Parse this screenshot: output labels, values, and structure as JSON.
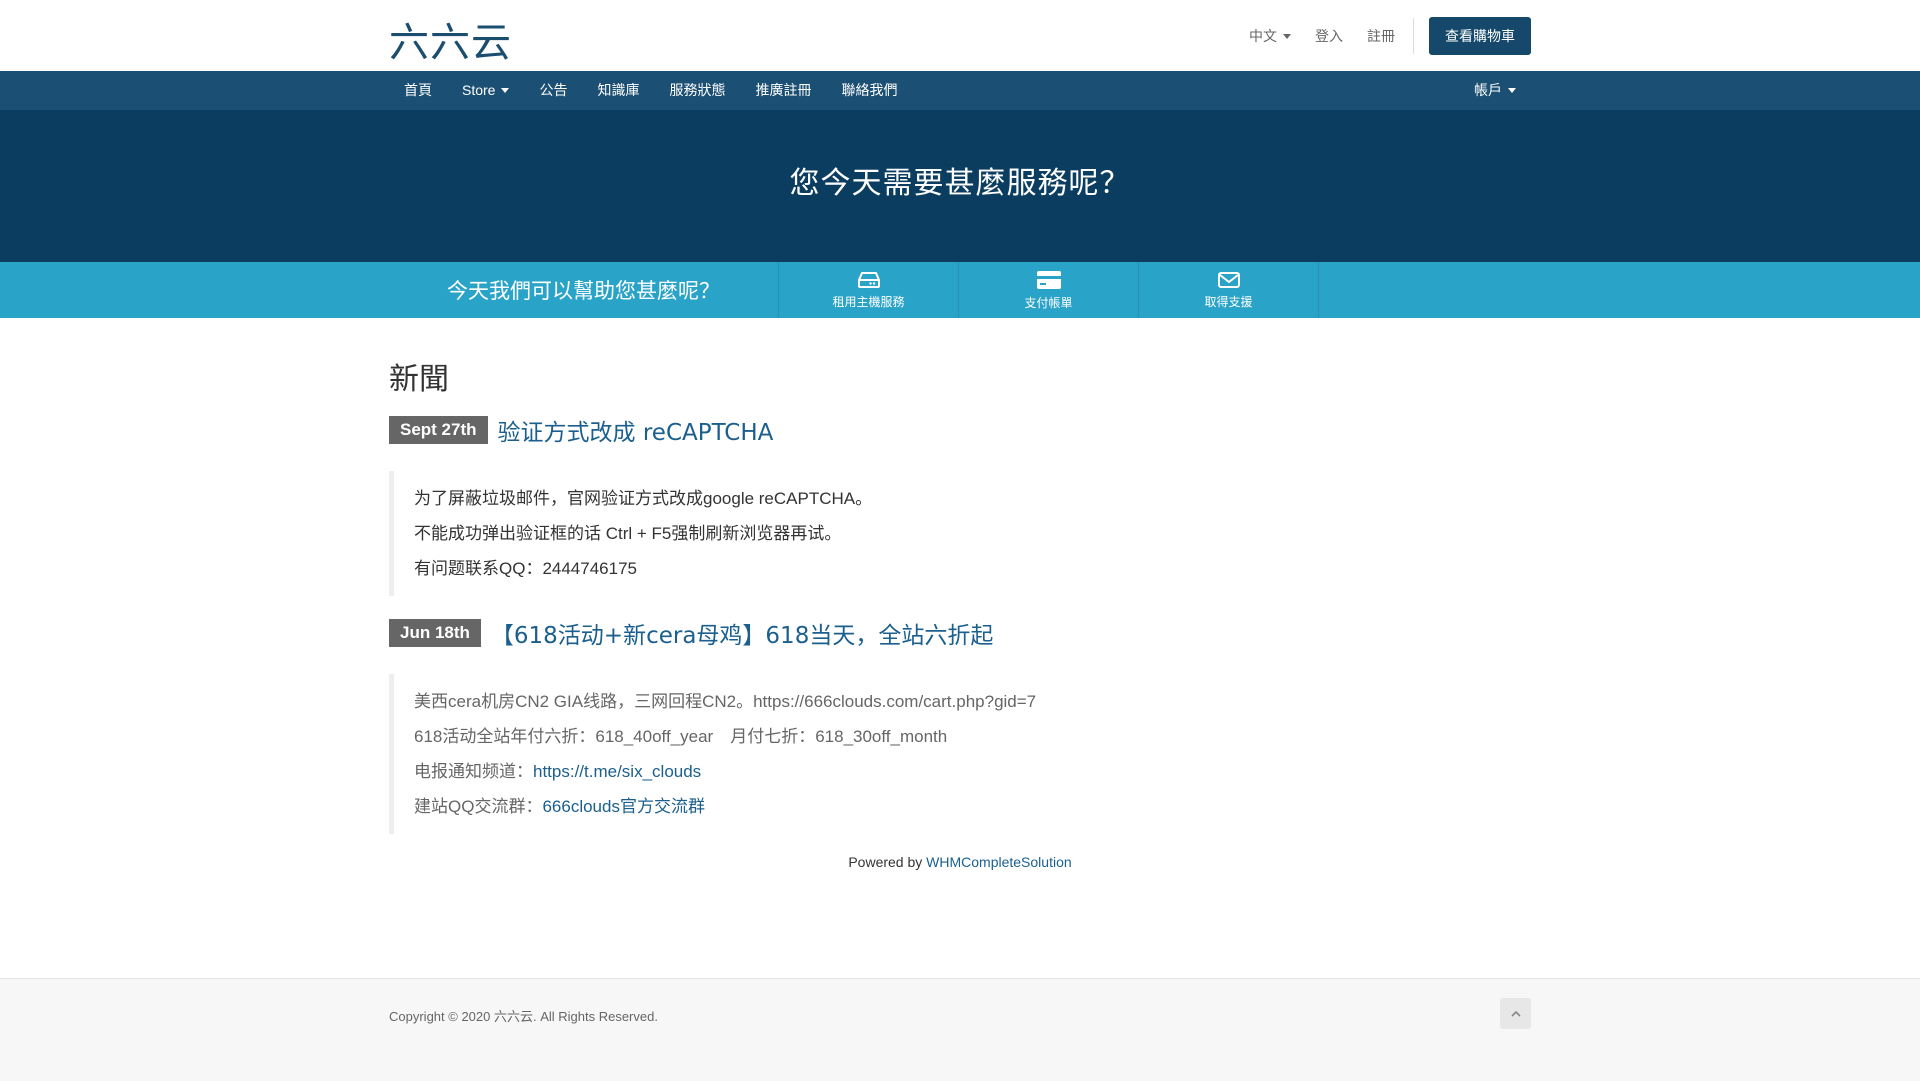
{
  "header": {
    "logo": "六六云",
    "language": "中文",
    "login": "登入",
    "register": "註冊",
    "cart_button": "查看購物車"
  },
  "nav": {
    "items": [
      {
        "label": "首頁"
      },
      {
        "label": "Store",
        "dropdown": true
      },
      {
        "label": "公告"
      },
      {
        "label": "知識庫"
      },
      {
        "label": "服務狀態"
      },
      {
        "label": "推廣註冊"
      },
      {
        "label": "聯絡我們"
      }
    ],
    "account": "帳戶"
  },
  "hero": {
    "title": "您今天需要甚麼服務呢？"
  },
  "quickbar": {
    "title": "今天我們可以幫助您甚麼呢？",
    "items": [
      {
        "label": "租用主機服務",
        "icon": "hdd-icon"
      },
      {
        "label": "支付帳單",
        "icon": "credit-card-icon"
      },
      {
        "label": "取得支援",
        "icon": "envelope-icon"
      }
    ]
  },
  "news": {
    "section_title": "新聞",
    "items": [
      {
        "date": "Sept 27th",
        "title": "验证方式改成 reCAPTCHA",
        "lines": [
          "为了屏蔽垃圾邮件，官网验证方式改成google reCAPTCHA。",
          "不能成功弹出验证框的话 Ctrl + F5强制刷新浏览器再试。",
          "有问题联系QQ：2444746175"
        ]
      },
      {
        "date": "Jun 18th",
        "title": "【618活动+新cera母鸡】618当天，全站六折起",
        "line1": "美西cera机房CN2 GIA线路，三网回程CN2。https://666clouds.com/cart.php?gid=7",
        "line2": "618活动全站年付六折：618_40off_year　月付七折：618_30off_month",
        "line3_prefix": "电报通知频道：",
        "line3_link": "https://t.me/six_clouds",
        "line4_prefix": "建站QQ交流群：",
        "line4_link": "666clouds官方交流群"
      }
    ]
  },
  "powered": {
    "prefix": "Powered by ",
    "link": "WHMCompleteSolution"
  },
  "footer": {
    "copyright": "Copyright © 2020 六六云. All Rights Reserved."
  },
  "colors": {
    "nav": "#1b4f73",
    "hero": "#0b3d60",
    "quickbar": "#2aa3c8",
    "link": "#1b5f8e"
  }
}
